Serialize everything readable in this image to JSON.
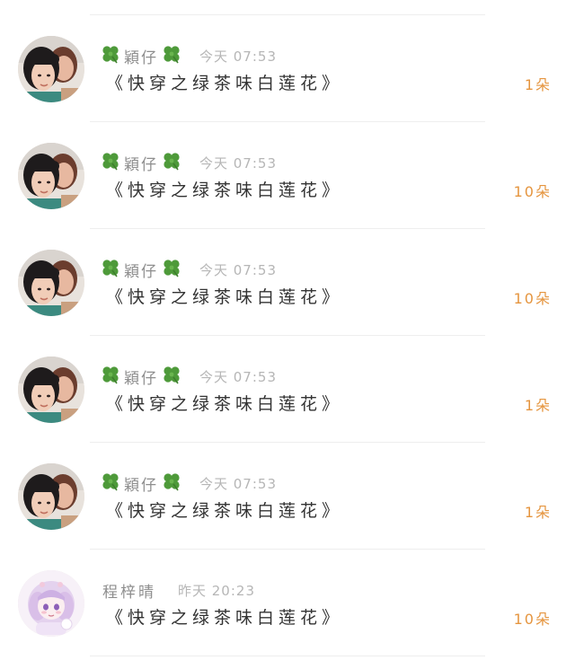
{
  "rows": [
    {
      "avatar_icon": "user-photo-icon",
      "username": "穎仔",
      "decorations": "clover-icon",
      "time": "今天 07:53",
      "title": "《快穿之绿茶味白莲花》",
      "count": "1朵"
    },
    {
      "avatar_icon": "user-photo-icon",
      "username": "穎仔",
      "decorations": "clover-icon",
      "time": "今天 07:53",
      "title": "《快穿之绿茶味白莲花》",
      "count": "10朵"
    },
    {
      "avatar_icon": "user-photo-icon",
      "username": "穎仔",
      "decorations": "clover-icon",
      "time": "今天 07:53",
      "title": "《快穿之绿茶味白莲花》",
      "count": "10朵"
    },
    {
      "avatar_icon": "user-photo-icon",
      "username": "穎仔",
      "decorations": "clover-icon",
      "time": "今天 07:53",
      "title": "《快穿之绿茶味白莲花》",
      "count": "1朵"
    },
    {
      "avatar_icon": "user-photo-icon",
      "username": "穎仔",
      "decorations": "clover-icon",
      "time": "今天 07:53",
      "title": "《快穿之绿茶味白莲花》",
      "count": "1朵"
    },
    {
      "avatar_icon": "anime-avatar-icon",
      "username": "程梓晴",
      "decorations": "",
      "time": "昨天 20:23",
      "title": "《快穿之绿茶味白莲花》",
      "count": "10朵"
    }
  ],
  "colors": {
    "username": "#8e8e8e",
    "time": "#b6b6b6",
    "title": "#333333",
    "count": "#e5953f",
    "clover": "#4e9a3a",
    "divider": "#eeeeee"
  }
}
